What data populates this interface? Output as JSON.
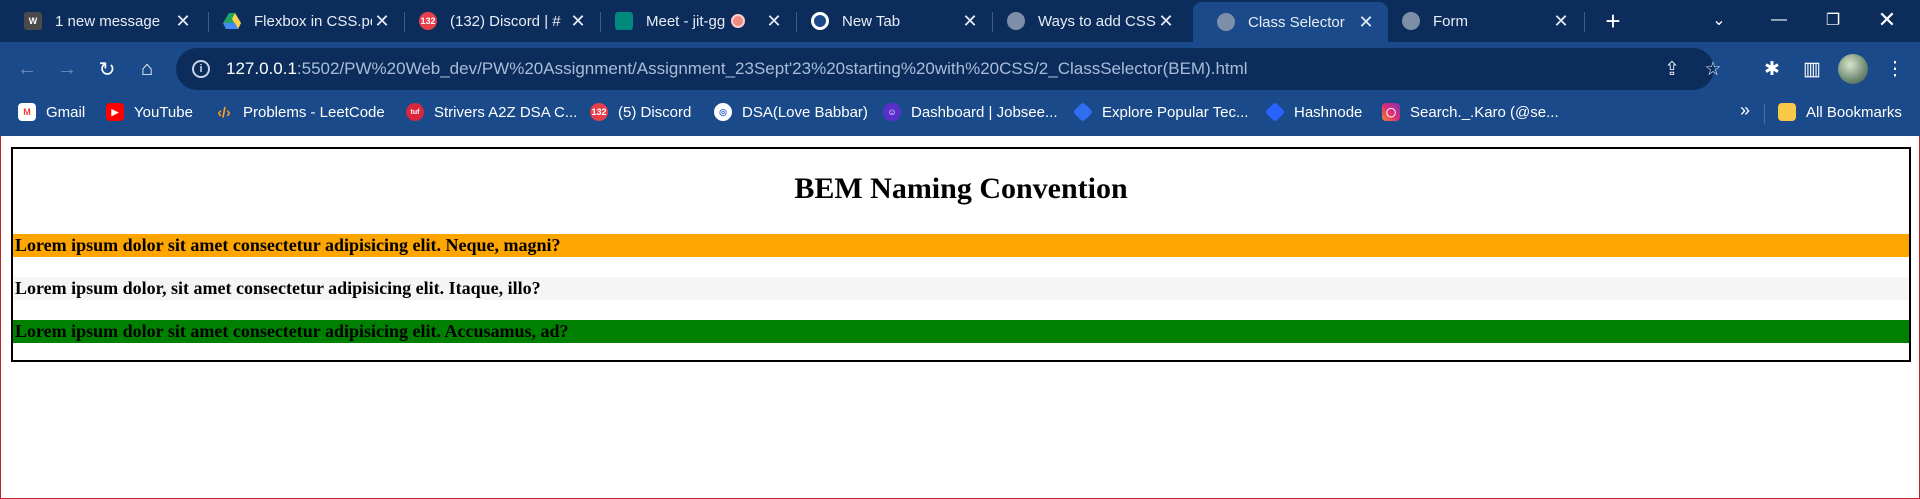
{
  "browser": {
    "tabs": [
      {
        "title": "1 new message",
        "favicon": "wordpress-icon",
        "color": "#4a4a4a"
      },
      {
        "title": "Flexbox in CSS.pdf",
        "favicon": "google-drive-icon",
        "color": "#1fa463"
      },
      {
        "title": "(132) Discord | #",
        "favicon": "discord-icon",
        "color": "#e8404a",
        "badge": "132"
      },
      {
        "title": "Meet - jit-gg",
        "favicon": "google-meet-icon",
        "color": "#00897b"
      },
      {
        "title": "New Tab",
        "favicon": "chrome-icon",
        "color": "#ffffff"
      },
      {
        "title": "Ways to add CSS",
        "favicon": "globe-icon",
        "color": "#7d8fa8"
      },
      {
        "title": "Class Selector",
        "favicon": "globe-icon",
        "color": "#7d8fa8",
        "active": true
      },
      {
        "title": "Form",
        "favicon": "globe-icon",
        "color": "#7d8fa8"
      }
    ],
    "address": {
      "host": "127.0.0.1",
      "path": ":5502/PW%20Web_dev/PW%20Assignment/Assignment_23Sept'23%20starting%20with%20CSS/2_ClassSelector(BEM).html"
    },
    "bookmarks": [
      {
        "label": "Gmail",
        "icon": "gmail-icon",
        "color": "#ea4335"
      },
      {
        "label": "YouTube",
        "icon": "youtube-icon",
        "color": "#ff0000"
      },
      {
        "label": "Problems - LeetCode",
        "icon": "leetcode-icon",
        "color": "#ffa116"
      },
      {
        "label": "Strivers A2Z DSA C...",
        "icon": "takeuforward-icon",
        "color": "#d7263d"
      },
      {
        "label": "(5) Discord",
        "icon": "discord-icon",
        "color": "#e8404a",
        "badge": "132"
      },
      {
        "label": "DSA(Love Babbar)",
        "icon": "codehelp-icon",
        "color": "#3b6fd6"
      },
      {
        "label": "Dashboard | Jobsee...",
        "icon": "jobseeker-icon",
        "color": "#5b2dc9"
      },
      {
        "label": "Explore Popular Tec...",
        "icon": "diamond-icon",
        "color": "#2f6ef2"
      },
      {
        "label": "Hashnode",
        "icon": "hashnode-icon",
        "color": "#2962ff"
      },
      {
        "label": "Search._.Karo (@se...",
        "icon": "instagram-icon",
        "color": "#d6249f"
      }
    ],
    "all_bookmarks": "All Bookmarks"
  },
  "page": {
    "heading": "BEM Naming Convention",
    "paragraphs": [
      {
        "text": "Lorem ipsum dolor sit amet consectetur adipisicing elit. Neque, magni?",
        "bg": "#ffa500"
      },
      {
        "text": "Lorem ipsum dolor, sit amet consectetur adipisicing elit. Itaque, illo?",
        "bg": "#f5f5f5"
      },
      {
        "text": "Lorem ipsum dolor sit amet consectetur adipisicing elit. Accusamus, ad?",
        "bg": "#008000"
      }
    ]
  }
}
